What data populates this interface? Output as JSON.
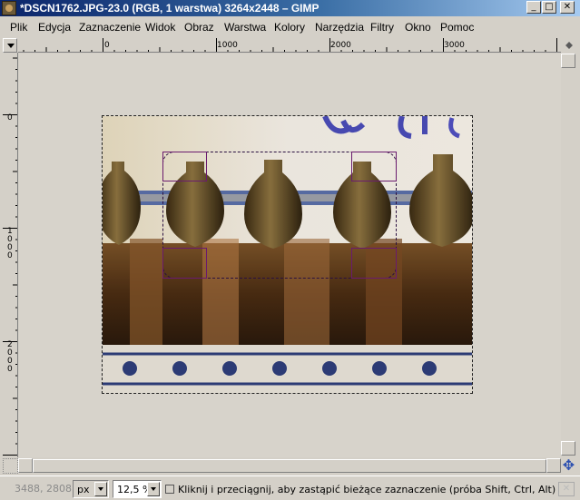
{
  "window": {
    "title": "*DSCN1762.JPG-23.0 (RGB, 1 warstwa) 3264x2448 – GIMP",
    "controls": {
      "minimize": "_",
      "maximize": "□",
      "close": "✕"
    }
  },
  "menu": [
    "Plik",
    "Edycja",
    "Zaznaczenie",
    "Widok",
    "Obraz",
    "Warstwa",
    "Kolory",
    "Narzędzia",
    "Filtry",
    "Okno",
    "Pomoc"
  ],
  "rulers": {
    "horizontal_labels": [
      "0",
      "1000",
      "2000",
      "3000"
    ],
    "vertical_labels": [
      "0",
      "1000",
      "2000"
    ]
  },
  "icons": {
    "corner": "triangle-down-icon",
    "navigate": "navigate-cross-icon",
    "quick_mask": "quick-mask-icon",
    "status": "selection-tool-icon"
  },
  "statusbar": {
    "coords": "3488, 2808",
    "unit": "px",
    "zoom": "12,5 %",
    "message": "Kliknij i przeciągnij, aby zastąpić bieżące zaznaczenie (próba Shift, Ctrl, Alt)"
  },
  "colors": {
    "titlebar_start": "#0a246a",
    "titlebar_end": "#a6caf0",
    "selection_handle": "#6a1b6e",
    "canvas_bg": "#d7d3cb"
  }
}
